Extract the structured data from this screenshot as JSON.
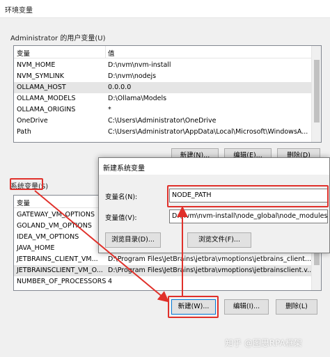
{
  "window": {
    "title": "环境变量"
  },
  "user_vars": {
    "label": "Administrator 的用户变量(U)",
    "col_var": "变量",
    "col_val": "值",
    "rows": [
      {
        "name": "NVM_HOME",
        "value": "D:\\nvm\\nvm-install"
      },
      {
        "name": "NVM_SYMLINK",
        "value": "D:\\nvm\\nodejs"
      },
      {
        "name": "OLLAMA_HOST",
        "value": "0.0.0.0"
      },
      {
        "name": "OLLAMA_MODELS",
        "value": "D:\\Ollama\\Models"
      },
      {
        "name": "OLLAMA_ORIGINS",
        "value": "*"
      },
      {
        "name": "OneDrive",
        "value": "C:\\Users\\Administrator\\OneDrive"
      },
      {
        "name": "Path",
        "value": "C:\\Users\\Administrator\\AppData\\Local\\Microsoft\\WindowsA..."
      }
    ],
    "buttons": {
      "new": "新建(N)...",
      "edit": "编辑(E)...",
      "delete": "删除(D)"
    }
  },
  "sys_vars": {
    "label": "系统变量(S)",
    "col_var": "变量",
    "rows": [
      {
        "name": "GATEWAY_VM_OPTIONS",
        "value": ""
      },
      {
        "name": "GOLAND_VM_OPTIONS",
        "value": ""
      },
      {
        "name": "IDEA_VM_OPTIONS",
        "value": ""
      },
      {
        "name": "JAVA_HOME",
        "value": ""
      },
      {
        "name": "JETBRAINS_CLIENT_VM...",
        "value": "D:\\Program Files\\JetBrains\\jetbra\\vmoptions\\jetbrains_client...."
      },
      {
        "name": "JETBRAINSCLIENT_VM_O...",
        "value": "D:\\Program Files\\JetBrains\\jetbra\\vmoptions\\jetbrainsclient.v..."
      },
      {
        "name": "NUMBER_OF_PROCESSORS",
        "value": "4"
      }
    ],
    "buttons": {
      "new": "新建(W)...",
      "edit": "编辑(I)...",
      "delete": "删除(L)"
    }
  },
  "dialog": {
    "title": "新建系统变量",
    "name_label": "变量名(N):",
    "value_label": "变量值(V):",
    "name_value": "NODE_PATH",
    "value_value": "D:\\nvm\\nvm-install\\node_global\\node_modules",
    "browse_dir": "浏览目录(D)...",
    "browse_file": "浏览文件(F)..."
  },
  "watermark": "知乎 @图思RPA框架",
  "colors": {
    "annotation": "#e0302a",
    "selection": "#e5e5e5",
    "focus": "#0078d7"
  }
}
